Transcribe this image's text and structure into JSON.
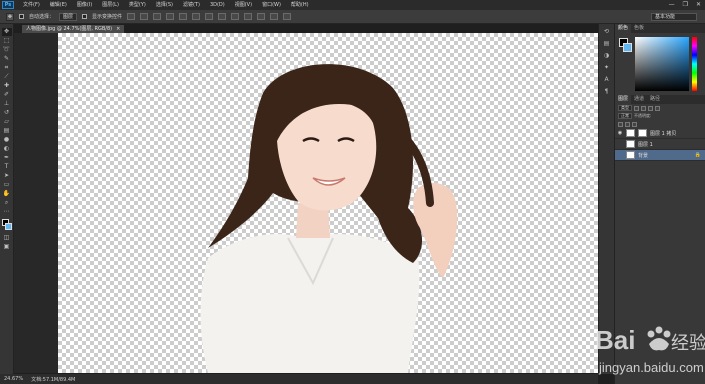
{
  "menubar": {
    "logo": "Ps",
    "items": [
      "文件(F)",
      "编辑(E)",
      "图像(I)",
      "图层(L)",
      "类型(Y)",
      "选择(S)",
      "滤镜(T)",
      "3D(D)",
      "视图(V)",
      "窗口(W)",
      "帮助(H)"
    ],
    "minimize": "—",
    "restore": "❐",
    "close": "✕"
  },
  "options": {
    "auto_select_label": "自动选择：",
    "auto_select_value": "图层",
    "show_transform_label": "显示变换控件",
    "workspace": "基本功能"
  },
  "document": {
    "tab_title": "人物图像.jpg @ 24.7%(图层, RGB/8)",
    "close": "×"
  },
  "toolbox": {
    "tools": [
      "move",
      "marquee",
      "lasso",
      "quick-select",
      "crop",
      "eyedropper",
      "healing",
      "brush",
      "stamp",
      "history-brush",
      "eraser",
      "gradient",
      "blur",
      "dodge",
      "pen",
      "type",
      "path-select",
      "shape",
      "hand",
      "zoom"
    ]
  },
  "statusbar": {
    "zoom": "24.67%",
    "doc_info": "文档:57.1M/89.4M"
  },
  "panels": {
    "color_tabs": [
      "颜色",
      "色板"
    ],
    "layers_tabs": [
      "图层",
      "通道",
      "路径"
    ],
    "kind_filter": "类型",
    "blend_mode": "正常",
    "opacity_label": "不透明度:",
    "layers": [
      {
        "name": "图层 1 拷贝",
        "visible": true,
        "selected": false
      },
      {
        "name": "图层 1",
        "visible": true,
        "selected": false
      },
      {
        "name": "背景",
        "visible": true,
        "selected": true,
        "locked": true
      }
    ]
  },
  "watermark": {
    "brand": "Bai",
    "brand_tail": "经验",
    "url": "jingyan.baidu.com"
  },
  "colors": {
    "foreground": "#000000",
    "background": "#5fb6f0",
    "selected_layer": "#4f6a8a"
  }
}
